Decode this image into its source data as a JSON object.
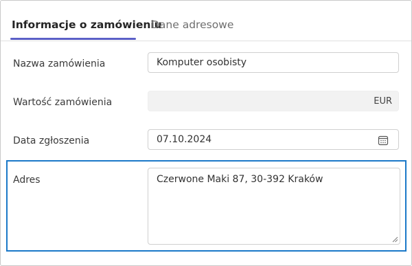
{
  "tabs": [
    {
      "label": "Informacje o zamówieniu",
      "active": true
    },
    {
      "label": "Dane adresowe",
      "active": false
    }
  ],
  "form": {
    "order_name": {
      "label": "Nazwa zamówienia",
      "value": "Komputer osobisty"
    },
    "order_value": {
      "label": "Wartość zamówienia",
      "value": "",
      "currency": "EUR",
      "disabled": true
    },
    "report_date": {
      "label": "Data zgłoszenia",
      "value": "07.10.2024",
      "icon": "calendar-icon"
    },
    "address": {
      "label": "Adres",
      "value": "Czerwone Maki 87, 30-392 Kraków"
    }
  },
  "colors": {
    "accent_tab": "#5b5fc7",
    "focus_border": "#1a78c8"
  }
}
